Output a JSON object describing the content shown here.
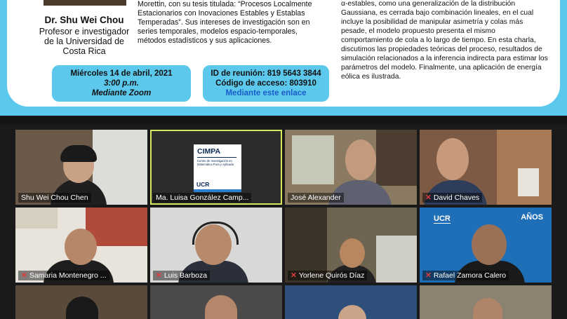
{
  "slide": {
    "speaker": {
      "name": "Dr. Shu Wei Chou",
      "title_lines": [
        "Profesor e investigador",
        "de la Universidad de",
        "Costa Rica"
      ]
    },
    "abstract_lines": [
      "Morettin, con su tesis titulada: “Procesos Localmente",
      "Estacionarios con Inovaciones Estables y Establas",
      "Temperadas”. Sus intereses de investigación son en",
      "series temporales, modelos espacio-temporales,",
      "métodos estadísticos y sus aplicaciones."
    ],
    "abstract_right_lines": [
      "α-estables, como una generalización de la distribución",
      "Gaussiana, es cerrada bajo combinación lineales, en el cual",
      "incluye la posibilidad de manipular asimetría y colas más",
      "pesade, el modelo propuesto presenta el mismo",
      "comportamiento de cola a lo largo de tiempo. En esta charla,",
      "discutimos las propiedades teóricas del proceso, resultados de",
      "simulación relacionados a la inferencia indirecta para estimar los",
      "parámetros del modelo. Finalmente, una aplicación de energía",
      "eólica es ilustrada."
    ],
    "event": {
      "date": "Miércoles 14 de abril, 2021",
      "time": "3:00 p.m.",
      "platform": "Mediante Zoom",
      "meeting_id": "ID de reunión: 819 5643 3844",
      "access_code": "Código de acceso: 803910",
      "link_text": "Mediante este enlace"
    }
  },
  "active_tile_card": {
    "title": "CIMPA",
    "subtitle": "Centro de Investigación en Matemática Pura y Aplicada",
    "org": "UCR"
  },
  "branding": {
    "ucr": "UCR",
    "anos": "AÑOS"
  },
  "participants": [
    {
      "name": "Shu Wei Chou Chen",
      "muted": false
    },
    {
      "name": "Ma. Luisa González Camp...",
      "muted": false
    },
    {
      "name": "José Alexander",
      "muted": false
    },
    {
      "name": "David Chaves",
      "muted": true
    },
    {
      "name": "Samaria Montenegro ...",
      "muted": true
    },
    {
      "name": "Luis Barboza",
      "muted": true
    },
    {
      "name": "Yorlene Quirós Díaz",
      "muted": true
    },
    {
      "name": "Rafael Zamora Calero",
      "muted": true
    }
  ],
  "colors": {
    "slide_accent": "#5cc8ec",
    "active_speaker_border": "#d8e85a",
    "muted_icon": "#e23b3b",
    "background": "#1a1a1a"
  }
}
